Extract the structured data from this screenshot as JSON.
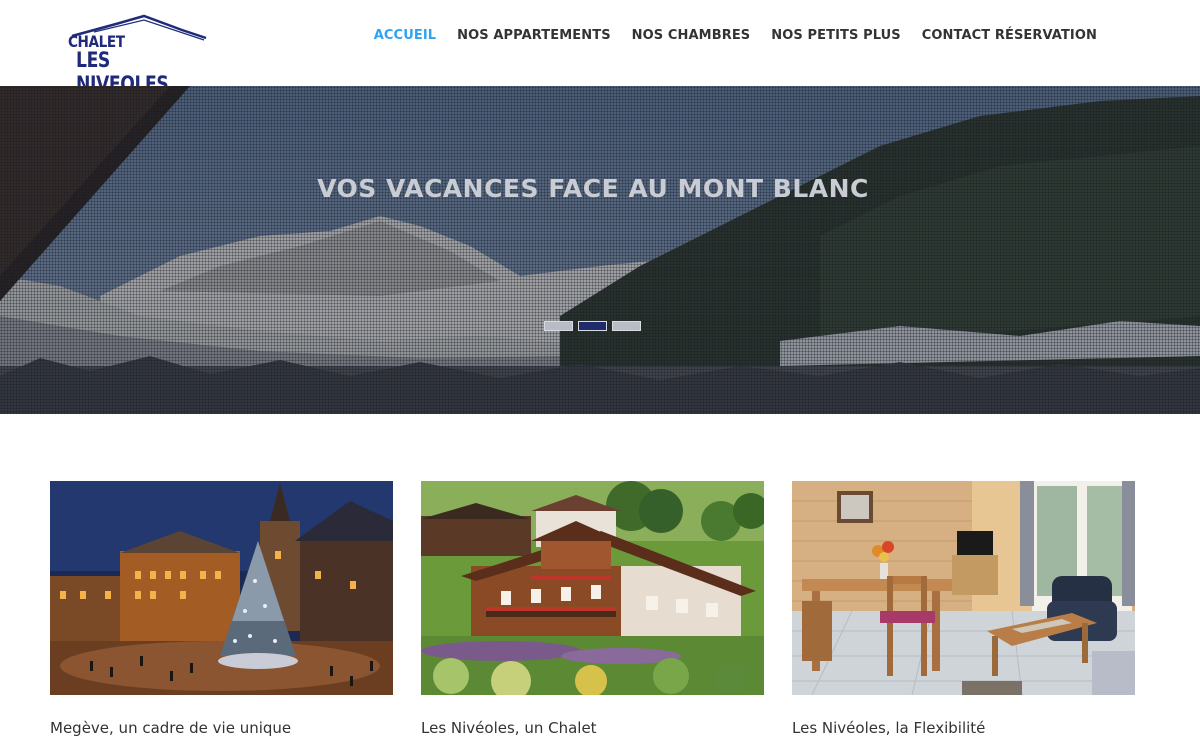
{
  "site": {
    "logo_line1": "CHALET",
    "logo_line2": "LES NIVEOLES",
    "brand_color": "#1f2b7a",
    "accent_color": "#2ea3f2"
  },
  "nav": {
    "items": [
      {
        "label": "ACCUEIL",
        "active": true
      },
      {
        "label": "NOS APPARTEMENTS",
        "active": false
      },
      {
        "label": "NOS CHAMBRES",
        "active": false
      },
      {
        "label": "NOS PETITS PLUS",
        "active": false
      },
      {
        "label": "CONTACT RÉSERVATION",
        "active": false
      }
    ]
  },
  "hero": {
    "title": "VOS VACANCES FACE AU MONT BLANC",
    "slides": 3,
    "active_slide": 2
  },
  "cards": [
    {
      "title": "Megève, un cadre de vie unique",
      "image": "megeve-night-christmas-tree"
    },
    {
      "title": "Les Nivéoles, un Chalet",
      "image": "chalet-summer-meadow"
    },
    {
      "title": "Les Nivéoles, la Flexibilité",
      "image": "wooden-living-room"
    }
  ]
}
